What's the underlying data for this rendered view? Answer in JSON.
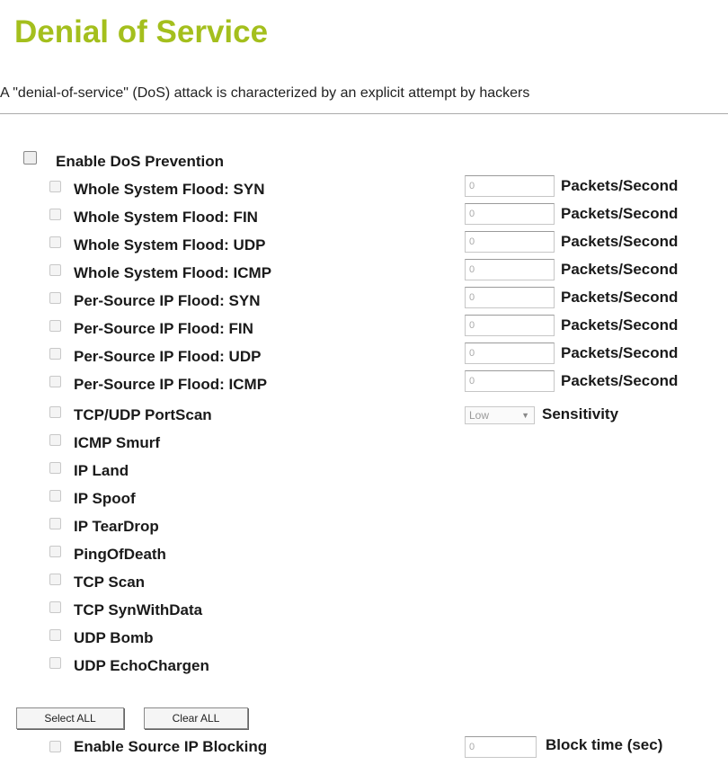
{
  "page": {
    "title": "Denial of Service",
    "description": "A \"denial-of-service\" (DoS) attack is characterized by an explicit attempt by hackers"
  },
  "dos": {
    "enable_label": "Enable DoS Prevention",
    "flood_items": [
      {
        "label": "Whole System Flood: SYN",
        "value": "0",
        "unit": "Packets/Second"
      },
      {
        "label": "Whole System Flood: FIN",
        "value": "0",
        "unit": "Packets/Second"
      },
      {
        "label": "Whole System Flood: UDP",
        "value": "0",
        "unit": "Packets/Second"
      },
      {
        "label": "Whole System Flood: ICMP",
        "value": "0",
        "unit": "Packets/Second"
      },
      {
        "label": "Per-Source IP Flood: SYN",
        "value": "0",
        "unit": "Packets/Second"
      },
      {
        "label": "Per-Source IP Flood: FIN",
        "value": "0",
        "unit": "Packets/Second"
      },
      {
        "label": "Per-Source IP Flood: UDP",
        "value": "0",
        "unit": "Packets/Second"
      },
      {
        "label": "Per-Source IP Flood: ICMP",
        "value": "0",
        "unit": "Packets/Second"
      }
    ],
    "portscan": {
      "label": "TCP/UDP PortScan",
      "sensitivity_value": "Low",
      "sensitivity_label": "Sensitivity"
    },
    "other_items": [
      "ICMP Smurf",
      "IP Land",
      "IP Spoof",
      "IP TearDrop",
      "PingOfDeath",
      "TCP Scan",
      "TCP SynWithData",
      "UDP Bomb",
      "UDP EchoChargen"
    ]
  },
  "buttons": {
    "select_all": "Select ALL",
    "clear_all": "Clear ALL"
  },
  "blocking": {
    "label": "Enable Source IP Blocking",
    "value": "0",
    "unit": "Block time (sec)"
  }
}
